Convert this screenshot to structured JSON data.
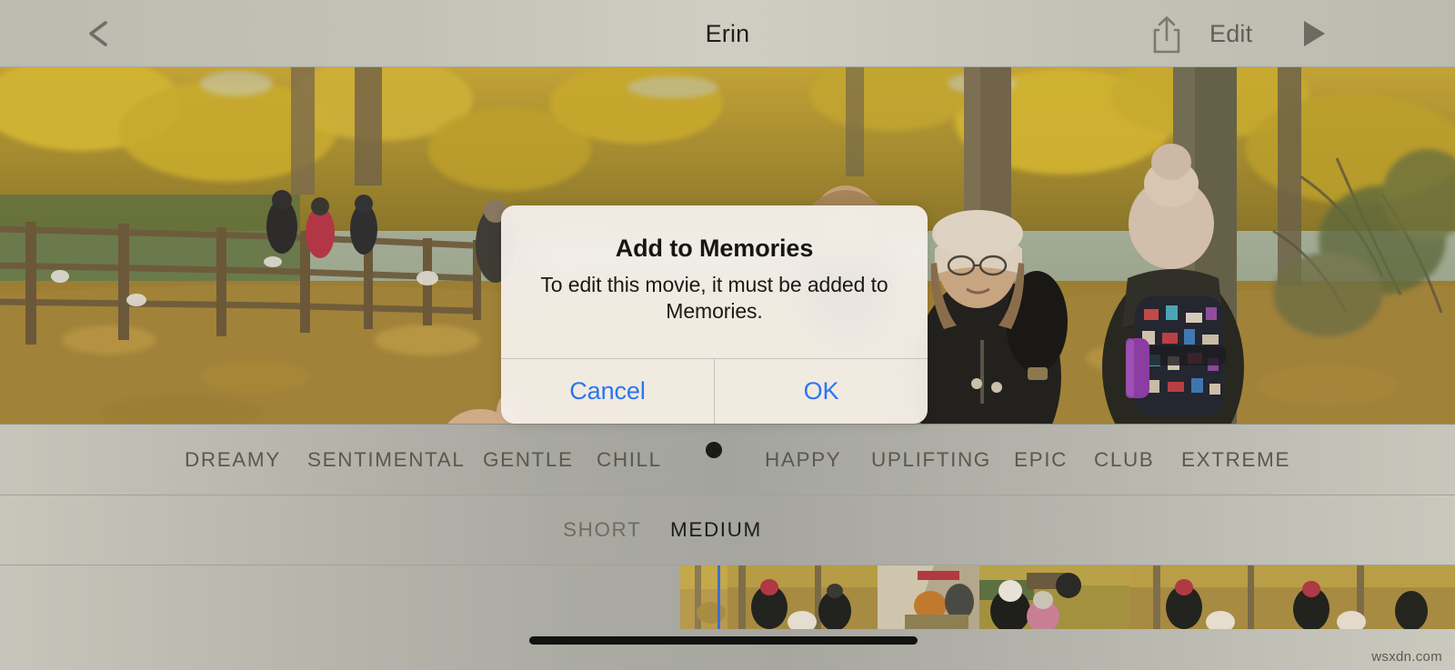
{
  "navbar": {
    "back_icon": "chevron-left-icon",
    "title": "Erin",
    "share_icon": "share-icon",
    "edit_label": "Edit",
    "play_icon": "play-icon"
  },
  "photo": {
    "description": "Autumn woodland path with fallen yellow leaves, wooden fence, bare and yellow-leafed trees, and a group of people in dark coats and knitted hats walking."
  },
  "mood_strip": {
    "items": [
      {
        "label": "DREAMY",
        "selected": false
      },
      {
        "label": "SENTIMENTAL",
        "selected": false
      },
      {
        "label": "GENTLE",
        "selected": false
      },
      {
        "label": "CHILL",
        "selected": false
      },
      {
        "label": "HAPPY",
        "selected": false
      },
      {
        "label": "UPLIFTING",
        "selected": false
      },
      {
        "label": "EPIC",
        "selected": false
      },
      {
        "label": "CLUB",
        "selected": false
      },
      {
        "label": "EXTREME",
        "selected": false
      }
    ],
    "selected_indicator": "dot",
    "selected_color": "#1a1a16"
  },
  "duration_strip": {
    "items": [
      {
        "label": "SHORT",
        "selected": false
      },
      {
        "label": "MEDIUM",
        "selected": true
      }
    ]
  },
  "filmstrip": {
    "playhead_color": "#3c6fd1",
    "frame_count": 5
  },
  "alert": {
    "title": "Add to Memories",
    "message": "To edit this movie, it must be added to Memories.",
    "cancel_label": "Cancel",
    "ok_label": "OK",
    "accent_color": "#2a76ef"
  },
  "watermark": {
    "text": "wsxdn.com"
  }
}
